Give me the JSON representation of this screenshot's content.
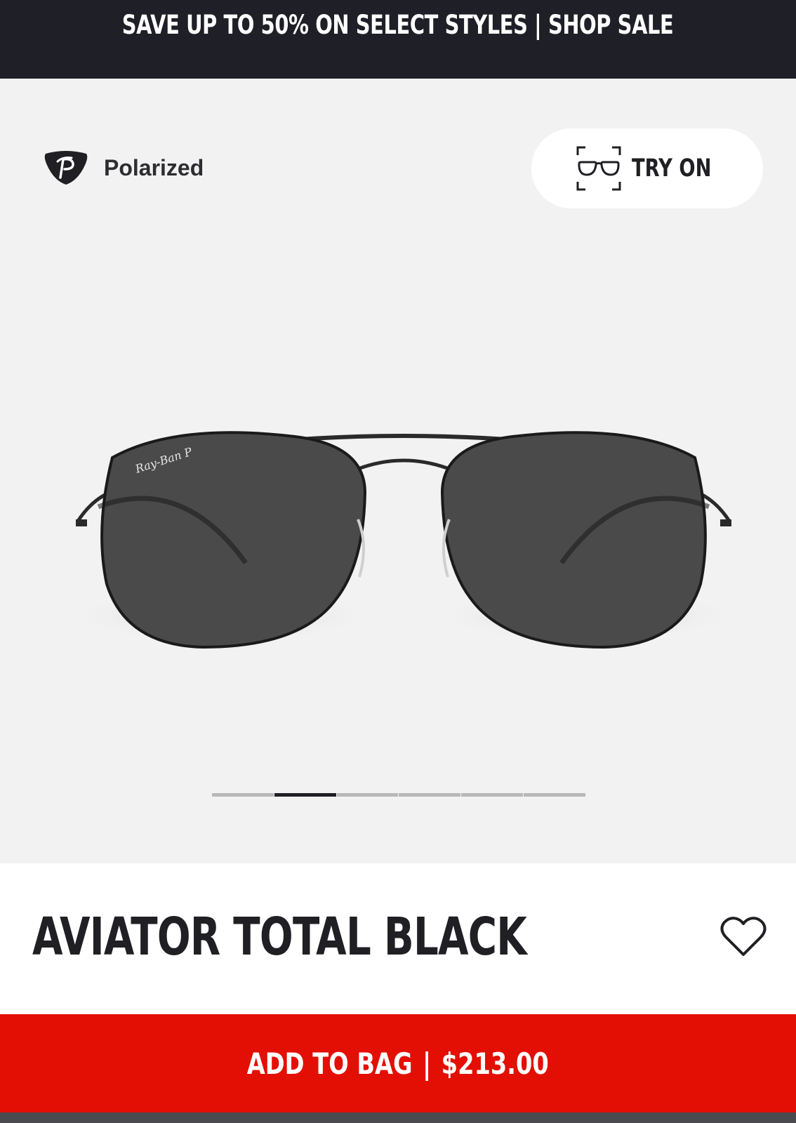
{
  "promo": {
    "text": "SAVE UP TO 50% ON SELECT STYLES | SHOP SALE"
  },
  "gallery": {
    "badge_label": "Polarized",
    "try_on_label": "TRY ON",
    "image_count": 6,
    "active_index": 1
  },
  "product": {
    "title": "AVIATOR TOTAL BLACK"
  },
  "cta": {
    "label": "ADD TO BAG",
    "separator": "|",
    "price": "$213.00"
  },
  "colors": {
    "promo_bg": "#1f1f27",
    "gallery_bg": "#f2f2f2",
    "cta_red": "#e30f04",
    "text_dark": "#1f1f24"
  },
  "icons": {
    "badge": "polarized-icon",
    "try_on": "glasses-scan-icon",
    "favorite": "heart-icon"
  }
}
